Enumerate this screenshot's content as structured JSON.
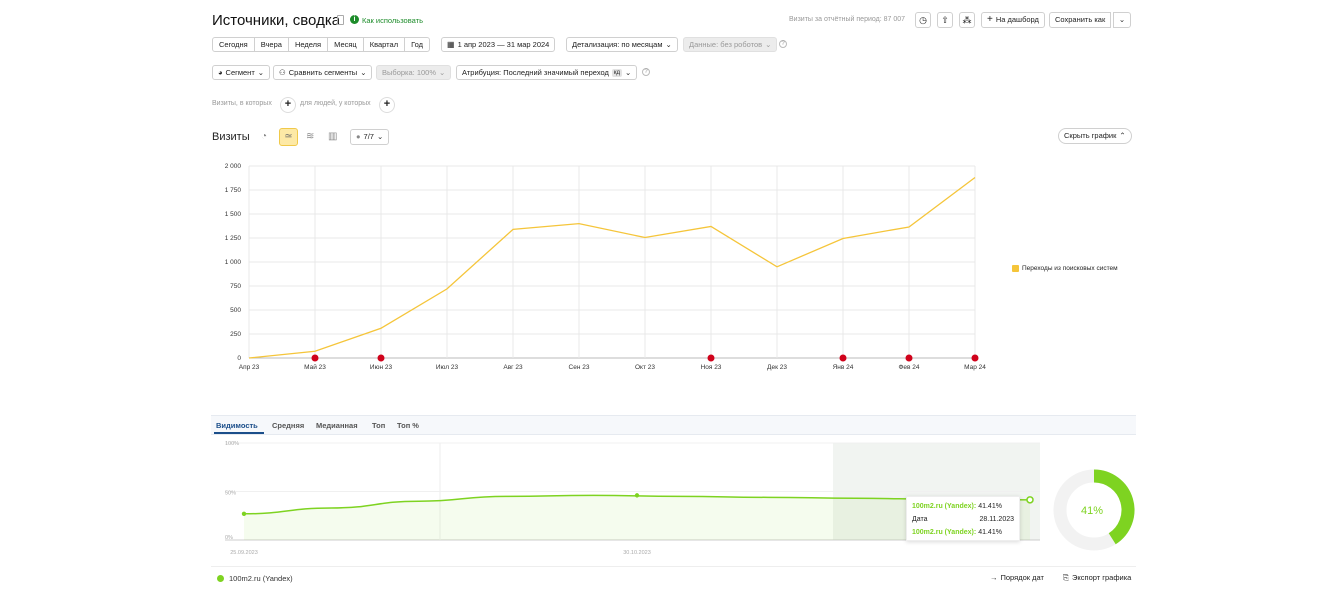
{
  "header": {
    "title": "Источники, сводка",
    "how_to": "Как использовать",
    "visits_period": "Визиты за отчётный период: 87 007",
    "to_dashboard": "На дашборд",
    "save_as": "Сохранить как"
  },
  "periods": [
    "Сегодня",
    "Вчера",
    "Неделя",
    "Месяц",
    "Квартал",
    "Год"
  ],
  "date_range": "1 апр 2023 — 31 мар 2024",
  "detail": "Детализация: по месяцам",
  "data_filter": "Данные: без роботов",
  "segment": "Сегмент",
  "compare_segments": "Сравнить сегменты",
  "sample": "Выборка: 100%",
  "attribution": "Атрибуция: Последний значимый переход",
  "attribution_badge": "кд",
  "filter_visits": "Визиты, в которых",
  "filter_people": "для людей, у которых",
  "chart_controls": {
    "label": "Визиты",
    "metrics": "7/7",
    "hide": "Скрыть график"
  },
  "chart_data": {
    "type": "line",
    "categories": [
      "Апр 23",
      "Май 23",
      "Июн 23",
      "Июл 23",
      "Авг 23",
      "Сен 23",
      "Окт 23",
      "Ноя 23",
      "Дек 23",
      "Янв 24",
      "Фев 24",
      "Мар 24"
    ],
    "series": [
      {
        "name": "Переходы из поисковых систем",
        "color": "#f5c53a",
        "values": [
          0,
          70,
          310,
          720,
          1340,
          1400,
          1255,
          1370,
          950,
          1245,
          1365,
          1880
        ]
      }
    ],
    "ylim": [
      0,
      2000
    ],
    "yticks": [
      "0",
      "250",
      "500",
      "750",
      "1 000",
      "1 250",
      "1 500",
      "1 750",
      "2 000"
    ],
    "grid": true,
    "legend": "right"
  },
  "visibility": {
    "tabs": [
      "Видимость",
      "Средняя",
      "Медианная",
      "Топ",
      "Топ %"
    ],
    "yticks": [
      "100%",
      "50%",
      "0%"
    ],
    "xlabels": [
      "25.09.2023",
      "30.10.2023"
    ],
    "series_name": "100m2.ru (Yandex)",
    "series_color": "#7ed321",
    "values": [
      27,
      33,
      40,
      45,
      46,
      45,
      44,
      43,
      42,
      41.41
    ],
    "tooltip": {
      "line1_label": "100m2.ru (Yandex):",
      "line1_value": "41.41%",
      "date_label": "Дата",
      "date_value": "28.11.2023",
      "line2_label": "100m2.ru (Yandex):",
      "line2_value": "41.41%"
    },
    "donut_value": 41,
    "donut_label": "41%",
    "sort": "Порядок дат",
    "export": "Экспорт графика"
  }
}
